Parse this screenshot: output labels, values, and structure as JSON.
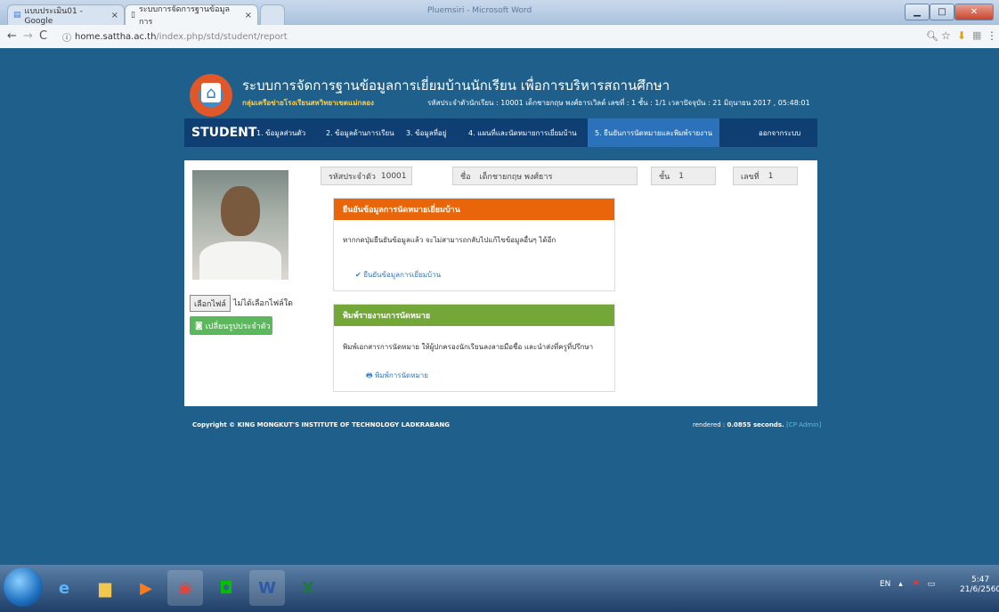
{
  "browser": {
    "tabs": [
      {
        "label": "แบบประเมิน01 - Google",
        "active": false
      },
      {
        "label": "ระบบการจัดการฐานข้อมูลการ",
        "active": true
      }
    ],
    "url_host": "home.sattha.ac.th",
    "url_path": "/index.php/std/student/report",
    "window_title": "Pluemsiri - Microsoft Word"
  },
  "site": {
    "title": "ระบบการจัดการฐานข้อมูลการเยี่ยมบ้านนักเรียน เพื่อการบริหารสถานศึกษา",
    "subtitle": "กลุ่มเครือข่ายโรงเรียนสหวิทยาเขตแม่กลอง",
    "student_info": "รหัสประจำตัวนักเรียน : 10001 เด็กชายกฤษ พงศ์ธารเวิลด์  เลขที่ : 1 ชั้น : 1/1  เวลาปัจจุบัน : 21 มิถุนายน 2017 , 05:48:01"
  },
  "menu": {
    "brand": "STUDENT",
    "items": [
      {
        "label": "1. ข้อมูลส่วนตัว"
      },
      {
        "label": "2. ข้อมูลด้านการเรียน"
      },
      {
        "label": "3. ข้อมูลที่อยู่"
      },
      {
        "label": "4. แผนที่และนัดหมายการเยี่ยมบ้าน"
      },
      {
        "label": "5. ยืนยันการนัดหมายและพิมพ์รายงาน"
      }
    ],
    "logout": "ออกจากระบบ"
  },
  "profile": {
    "file_button": "เลือกไฟล์",
    "file_status": "ไม่ได้เลือกไฟล์ใด",
    "change_photo": "เปลี่ยนรูปประจำตัว"
  },
  "fields": {
    "id_label": "รหัสประจำตัว",
    "id_value": "10001",
    "name_label": "ชื่อ",
    "name_value": "เด็กชายกฤษ พงศ์ธาร",
    "class_label": "ชั้น",
    "class_value": "1",
    "number_label": "เลขที่",
    "number_value": "1"
  },
  "panels": {
    "confirm": {
      "title": "ยืนยันข้อมูลการนัดหมายเยี่ยมบ้าน",
      "text": "หากกดปุ่มยืนยันข้อมูลแล้ว จะไม่สามารถกลับไปแก้ไขข้อมูลอื่นๆ ได้อีก",
      "link": "ยืนยันข้อมูลการเยี่ยมบ้าน",
      "header_color": "#e8650a"
    },
    "print": {
      "title": "พิมพ์รายงานการนัดหมาย",
      "text": "พิมพ์เอกสารการนัดหมาย ให้ผู้ปกครองนักเรียนลงลายมือชื่อ และนำส่งที่ครูที่ปรึกษา",
      "link": "พิมพ์การนัดหมาย",
      "header_color": "#73a839"
    }
  },
  "footer": {
    "copyright": "Copyright © KING MONGKUT'S INSTITUTE OF TECHNOLOGY LADKRABANG",
    "rendered_prefix": "rendered : ",
    "rendered_value": "0.0855",
    "rendered_suffix": " seconds. ",
    "admin": "[CP Admin]"
  },
  "taskbar": {
    "lang": "EN",
    "time": "5:47",
    "date": "21/6/2560"
  },
  "colors": {
    "page_bg": "#1f5f8b",
    "menu_bg": "#0f3e73",
    "menu_active": "#2c72ba",
    "accent_green": "#5cb85c"
  }
}
